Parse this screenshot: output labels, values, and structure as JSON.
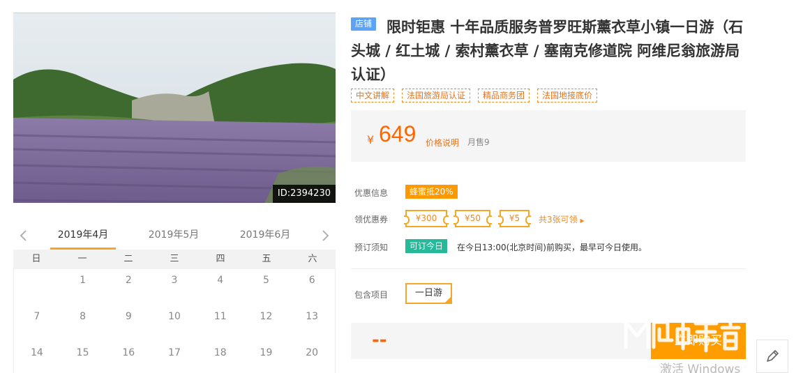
{
  "photo": {
    "id_label": "ID:2394230",
    "alt": ""
  },
  "calendar": {
    "tabs": [
      "2019年4月",
      "2019年5月",
      "2019年6月"
    ],
    "active_tab": 0,
    "weekdays": [
      "日",
      "一",
      "二",
      "三",
      "四",
      "五",
      "六"
    ],
    "rows": [
      [
        "",
        "1",
        "2",
        "3",
        "4",
        "5",
        "6"
      ],
      [
        "7",
        "8",
        "9",
        "10",
        "11",
        "12",
        "13"
      ],
      [
        "14",
        "15",
        "16",
        "17",
        "18",
        "19",
        "20"
      ]
    ]
  },
  "product": {
    "shop_badge": "店铺",
    "title": "限时钜惠 十年品质服务普罗旺斯薰衣草小镇一日游（石头城 / 红土城 / 索村薰衣草 / 塞南克修道院 阿维尼翁旅游局认证）",
    "tags": [
      "中文讲解",
      "法国旅游局认证",
      "精品商务团",
      "法国地接底价"
    ]
  },
  "price": {
    "currency": "¥",
    "amount": "649",
    "explain": "价格说明",
    "sold": "月售9"
  },
  "promo": {
    "label": "优惠信息",
    "badge": "蜂蜜抵20%"
  },
  "coupons": {
    "label": "领优惠券",
    "items": [
      "¥300",
      "¥50",
      "¥5"
    ],
    "more": "共3张可领"
  },
  "booking": {
    "label": "预订须知",
    "badge": "可订今日",
    "note": "在今日13:00(北京时间)前购买，最早可今日使用。"
  },
  "package": {
    "label": "包含项目",
    "option": "一日游"
  },
  "bottom": {
    "dash": "--",
    "buy": "立即购买"
  },
  "overlays": {
    "win_activate": "激活 Windows"
  },
  "colors": {
    "accent_orange": "#ff6600",
    "tag_orange": "#f08a24",
    "buy_button": "#ff9d00",
    "shop_badge_blue": "#5aa3f6",
    "book_badge_green": "#26b99a"
  }
}
